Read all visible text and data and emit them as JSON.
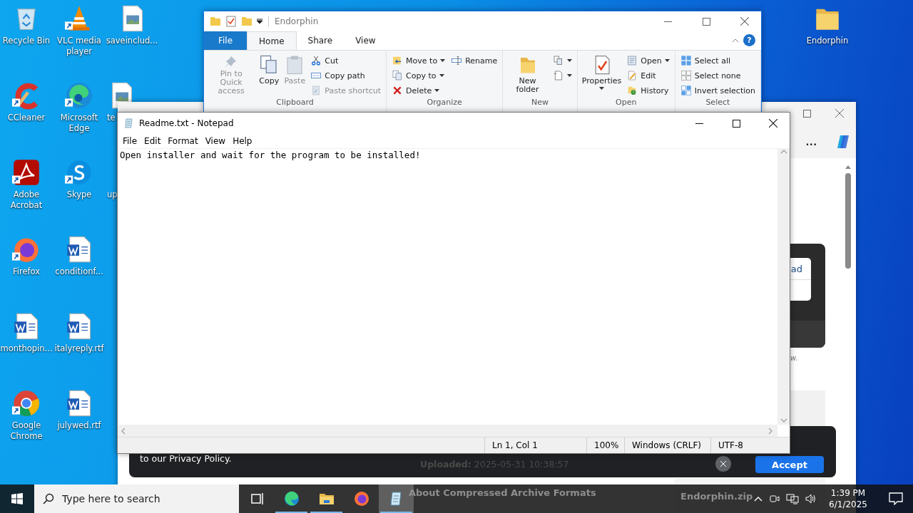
{
  "desktop_icons": [
    {
      "label": "Recycle Bin",
      "kind": "recycle",
      "shortcut": false,
      "clipped": false
    },
    {
      "label": "CCleaner",
      "kind": "ccleaner",
      "shortcut": true,
      "clipped": false
    },
    {
      "label": "Adobe Acrobat",
      "kind": "acrobat",
      "shortcut": true,
      "clipped": false
    },
    {
      "label": "Firefox",
      "kind": "firefox",
      "shortcut": true,
      "clipped": false
    },
    {
      "label": "monthopin...",
      "kind": "word",
      "shortcut": false,
      "clipped": false
    },
    {
      "label": "Google Chrome",
      "kind": "chrome",
      "shortcut": true,
      "clipped": false
    },
    {
      "label": "VLC media player",
      "kind": "vlc",
      "shortcut": true,
      "clipped": false
    },
    {
      "label": "Microsoft Edge",
      "kind": "edge",
      "shortcut": true,
      "clipped": false
    },
    {
      "label": "Skype",
      "kind": "skype",
      "shortcut": true,
      "clipped": false
    },
    {
      "label": "conditionf...",
      "kind": "word",
      "shortcut": false,
      "clipped": false
    },
    {
      "label": "italyreply.rtf",
      "kind": "word",
      "shortcut": false,
      "clipped": false
    },
    {
      "label": "julywed.rtf",
      "kind": "word",
      "shortcut": false,
      "clipped": false
    },
    {
      "label": "saveinclud...",
      "kind": "image",
      "shortcut": false,
      "clipped": false
    },
    {
      "label": "te",
      "kind": "image",
      "shortcut": false,
      "clipped": true
    },
    {
      "label": "up",
      "kind": "none",
      "clipped": true
    }
  ],
  "desktop_icons_right": [
    {
      "label": "Endorphin",
      "kind": "folder",
      "shortcut": false,
      "clipped": false
    }
  ],
  "explorer": {
    "title": "Endorphin",
    "tabs": [
      {
        "label": "File",
        "kind": "file",
        "selected": false
      },
      {
        "label": "Home",
        "kind": "tab",
        "selected": true
      },
      {
        "label": "Share",
        "kind": "tab",
        "selected": false
      },
      {
        "label": "View",
        "kind": "tab",
        "selected": false
      }
    ],
    "help": "?",
    "groups": [
      {
        "label": "Clipboard",
        "items": [
          {
            "label": "Pin to Quick access",
            "kind": "large",
            "disabled": true,
            "dropdown": false
          },
          {
            "label": "Copy",
            "kind": "large",
            "disabled": false,
            "dropdown": false
          },
          {
            "label": "Paste",
            "kind": "large",
            "disabled": true,
            "dropdown": false
          },
          {
            "label": "Cut",
            "kind": "small",
            "disabled": false,
            "dropdown": false
          },
          {
            "label": "Copy path",
            "kind": "small",
            "disabled": false,
            "dropdown": false
          },
          {
            "label": "Paste shortcut",
            "kind": "small",
            "disabled": true,
            "dropdown": false
          }
        ]
      },
      {
        "label": "Organize",
        "items": [
          {
            "label": "Move to",
            "kind": "small",
            "disabled": false,
            "dropdown": true
          },
          {
            "label": "Copy to",
            "kind": "small",
            "disabled": false,
            "dropdown": true
          },
          {
            "label": "Delete",
            "kind": "small",
            "disabled": false,
            "dropdown": true
          },
          {
            "label": "Rename",
            "kind": "small",
            "disabled": false,
            "dropdown": false
          }
        ]
      },
      {
        "label": "New",
        "items": [
          {
            "label": "New folder",
            "kind": "large",
            "disabled": false,
            "dropdown": false
          },
          {
            "kind": "icon",
            "disabled": false,
            "dropdown": true
          },
          {
            "kind": "icon",
            "disabled": false,
            "dropdown": true
          }
        ]
      },
      {
        "label": "Open",
        "items": [
          {
            "label": "Properties",
            "kind": "large",
            "disabled": false,
            "dropdown": true
          },
          {
            "label": "Open",
            "kind": "small",
            "disabled": false,
            "dropdown": true
          },
          {
            "label": "Edit",
            "kind": "small",
            "disabled": false,
            "dropdown": false
          },
          {
            "label": "History",
            "kind": "small",
            "disabled": false,
            "dropdown": false
          }
        ]
      },
      {
        "label": "Select",
        "items": [
          {
            "label": "Select all",
            "kind": "small",
            "disabled": false,
            "dropdown": false
          },
          {
            "label": "Select none",
            "kind": "small",
            "disabled": false,
            "dropdown": false
          },
          {
            "label": "Invert selection",
            "kind": "small",
            "disabled": false,
            "dropdown": false
          }
        ]
      }
    ]
  },
  "browser": {
    "more": "...",
    "link": "ad",
    "note": "w.",
    "cookie": {
      "text": "to our Privacy Policy.",
      "button": "Accept",
      "uploaded_label": "Uploaded:",
      "uploaded_value": "2025-05-31 10:38:57"
    },
    "heading": "About Compressed Archive Formats",
    "file_name": "Endorphin.zip"
  },
  "notepad": {
    "title": "Readme.txt - Notepad",
    "menu": [
      "File",
      "Edit",
      "Format",
      "View",
      "Help"
    ],
    "text": "Open installer and wait for the program to be installed!",
    "status": [
      "Ln 1, Col 1",
      "100%",
      "Windows (CRLF)",
      "UTF-8"
    ]
  },
  "taskbar": {
    "search_placeholder": "Type here to search",
    "apps": [
      {
        "kind": "taskview",
        "running": false,
        "selected": false
      },
      {
        "kind": "edge",
        "running": true,
        "selected": false
      },
      {
        "kind": "explorer",
        "running": true,
        "selected": false
      },
      {
        "kind": "firefox",
        "running": false,
        "selected": false
      },
      {
        "kind": "notepad",
        "running": true,
        "selected": true
      }
    ],
    "time": "1:39 PM",
    "date": "6/1/2025"
  }
}
